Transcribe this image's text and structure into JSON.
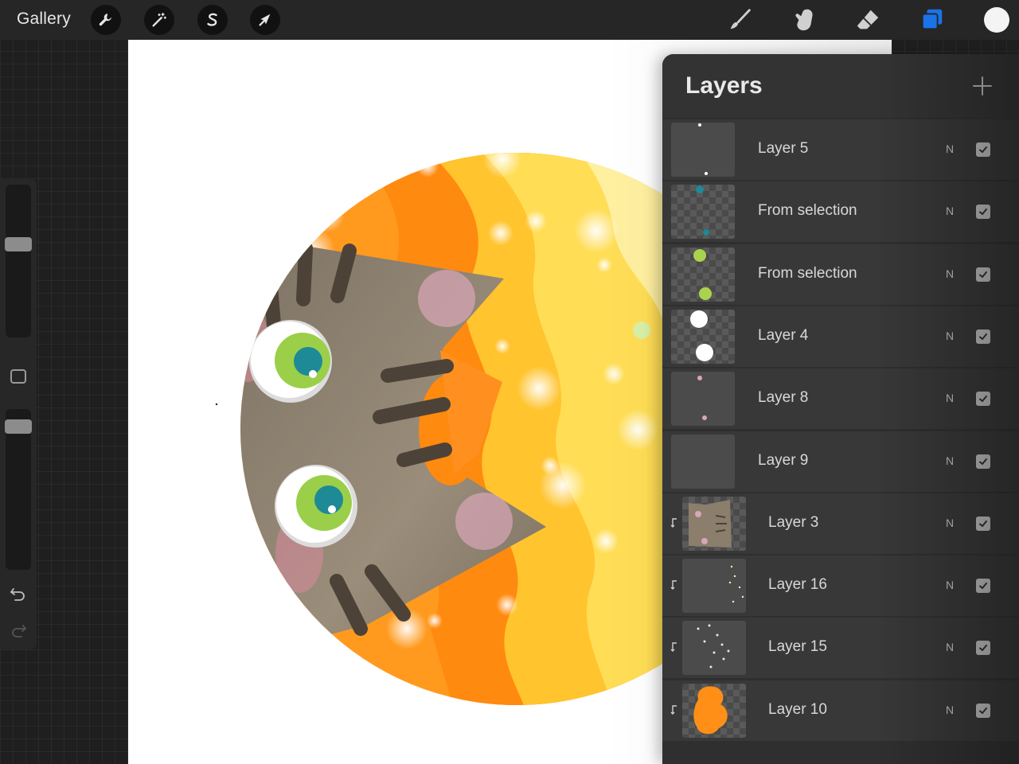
{
  "topbar": {
    "gallery_label": "Gallery",
    "left_tools": [
      {
        "name": "actions",
        "icon": "wrench-icon"
      },
      {
        "name": "adjustments",
        "icon": "magic-wand-icon"
      },
      {
        "name": "selection",
        "icon": "selection-s-icon"
      },
      {
        "name": "transform",
        "icon": "arrow-cursor-icon"
      }
    ],
    "right_tools": [
      {
        "name": "brush",
        "icon": "brush-icon",
        "active": false
      },
      {
        "name": "smudge",
        "icon": "smudge-finger-icon",
        "active": false
      },
      {
        "name": "eraser",
        "icon": "eraser-icon",
        "active": false
      },
      {
        "name": "layers",
        "icon": "layers-icon",
        "active": true
      }
    ],
    "current_color": "#f4f4f4",
    "active_color": "#1a73e8"
  },
  "sidebar": {
    "brush_size_level": 0.62,
    "opacity_level": 0.93
  },
  "layers_panel": {
    "title": "Layers",
    "add_button_icon": "plus-icon",
    "layers": [
      {
        "name": "Layer 5",
        "blend": "N",
        "visible": true,
        "clipped": false,
        "thumb": "dots"
      },
      {
        "name": "From selection",
        "blend": "N",
        "visible": true,
        "clipped": false,
        "thumb": "teal-dots"
      },
      {
        "name": "From selection",
        "blend": "N",
        "visible": true,
        "clipped": false,
        "thumb": "green-dots"
      },
      {
        "name": "Layer 4",
        "blend": "N",
        "visible": true,
        "clipped": false,
        "thumb": "white-dots"
      },
      {
        "name": "Layer 8",
        "blend": "N",
        "visible": true,
        "clipped": false,
        "thumb": "pink-dots"
      },
      {
        "name": "Layer 9",
        "blend": "N",
        "visible": true,
        "clipped": false,
        "thumb": "plain"
      },
      {
        "name": "Layer 3",
        "blend": "N",
        "visible": true,
        "clipped": true,
        "thumb": "cat"
      },
      {
        "name": "Layer 16",
        "blend": "N",
        "visible": true,
        "clipped": true,
        "thumb": "sparkles"
      },
      {
        "name": "Layer 15",
        "blend": "N",
        "visible": true,
        "clipped": true,
        "thumb": "stars"
      },
      {
        "name": "Layer 10",
        "blend": "N",
        "visible": true,
        "clipped": true,
        "thumb": "orange-shape"
      }
    ]
  },
  "artwork": {
    "colors": {
      "orange": "#ff9a1f",
      "yellow": "#ffc93a",
      "light_yellow": "#ffe36b",
      "cat_fur": "#8b7e6d",
      "stripe": "#4d4238",
      "eye_green": "#9bcf4a",
      "pupil": "#1d8a96"
    }
  }
}
